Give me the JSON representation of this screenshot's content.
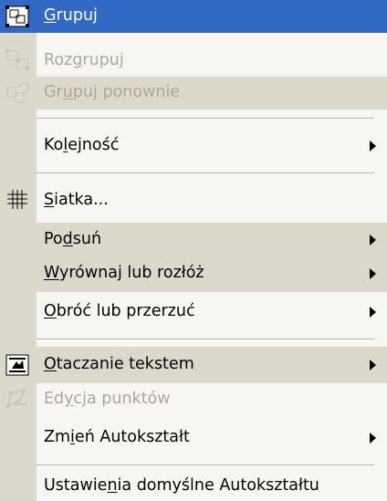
{
  "menu": {
    "items": [
      {
        "label_pre": "",
        "label_u": "G",
        "label_post": "rupuj",
        "icon": "group-icon"
      },
      {
        "label_pre": "Roz",
        "label_u": "g",
        "label_post": "rupuj",
        "icon": "ungroup-icon"
      },
      {
        "label_pre": "Gr",
        "label_u": "u",
        "label_post": "puj ponownie",
        "icon": "regroup-icon"
      },
      {
        "label_pre": "Ko",
        "label_u": "l",
        "label_post": "ejność",
        "submenu": true
      },
      {
        "label_pre": "",
        "label_u": "S",
        "label_post": "iatka...",
        "icon": "grid-icon"
      },
      {
        "label_pre": "Po",
        "label_u": "d",
        "label_post": "suń",
        "submenu": true
      },
      {
        "label_pre": "",
        "label_u": "W",
        "label_post": "yrównaj lub rozłóż",
        "submenu": true
      },
      {
        "label_pre": "",
        "label_u": "O",
        "label_post": "bróć lub przerzuć",
        "submenu": true
      },
      {
        "label_pre": "",
        "label_u": "O",
        "label_post": "taczanie tekstem",
        "icon": "text-wrapping-icon",
        "submenu": true
      },
      {
        "label_pre": "Ed",
        "label_u": "y",
        "label_post": "cja punktów",
        "icon": "edit-points-icon"
      },
      {
        "label_pre": "Zm",
        "label_u": "i",
        "label_post": "eń Autokształt",
        "submenu": true
      },
      {
        "label_pre": "Ustawie",
        "label_u": "n",
        "label_post": "ia domyślne Autokształtu"
      }
    ]
  }
}
